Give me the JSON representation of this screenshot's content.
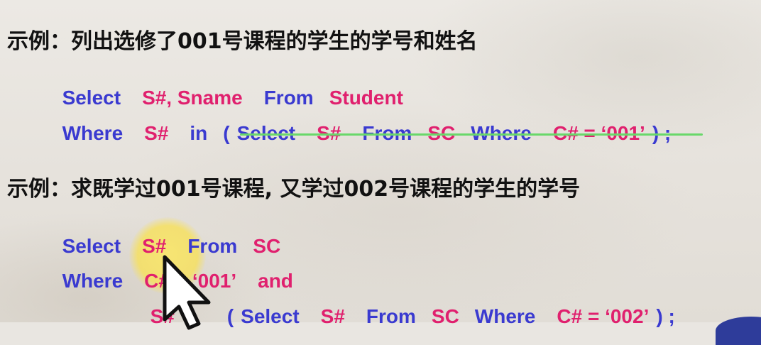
{
  "example1": {
    "heading": "示例：列出选修了001号课程的学生的学号和姓名",
    "line1": {
      "select": "Select",
      "cols": "S#, Sname",
      "from": "From",
      "table": "Student"
    },
    "line2": {
      "where": "Where",
      "col": "S#",
      "in": "in",
      "open_paren": "(",
      "select": "Select",
      "sub_col": "S#",
      "from": "From",
      "table": "SC",
      "where2": "Where",
      "cond": "C# = ‘001’",
      "close": ") ;"
    }
  },
  "example2": {
    "heading": "示例：求既学过001号课程, 又学过002号课程的学生的学号",
    "line1": {
      "select": "Select",
      "col": "S#",
      "from": "From",
      "table": "SC"
    },
    "line2": {
      "where": "Where",
      "cond": "C# = ‘001’",
      "and": "and"
    },
    "line3": {
      "col_partial": "S#",
      "open_paren": "(",
      "select": "Select",
      "sub_col": "S#",
      "from": "From",
      "table": "SC",
      "where2": "Where",
      "cond": "C# = ‘002’",
      "close": ") ;"
    }
  },
  "colors": {
    "keyword": "#3a3ad0",
    "identifier": "#e0206e",
    "heading": "#111111",
    "underline": "#69d86a",
    "highlight": "#f6e060"
  },
  "icons": {
    "cursor": "mouse-pointer-icon"
  }
}
